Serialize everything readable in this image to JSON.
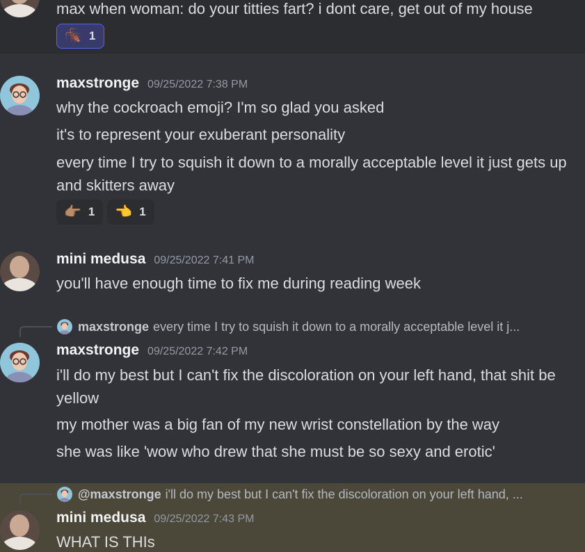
{
  "messages": [
    {
      "continued": true,
      "lines": [
        "max when woman: do your titties fart? i dont care, get out of my house"
      ],
      "reactions": [
        {
          "emoji": "🪳",
          "icon": "cockroach-icon",
          "count": "1",
          "active": true
        }
      ]
    },
    {
      "username": "maxstronge",
      "timestamp": "09/25/2022 7:38 PM",
      "lines": [
        "why the cockroach emoji? I'm so glad you asked",
        "it's to represent your exuberant personality",
        "every time I try to squish it down to a morally acceptable level it just gets up and skitters away"
      ],
      "reactions": [
        {
          "emoji": "👉🏽",
          "icon": "pointing-right-medium-skin-icon",
          "count": "1"
        },
        {
          "emoji": "👈",
          "icon": "pointing-left-icon",
          "count": "1"
        }
      ]
    },
    {
      "username": "mini medusa",
      "timestamp": "09/25/2022 7:41 PM",
      "lines": [
        "you'll have enough time to fix me during reading week"
      ]
    },
    {
      "reply": {
        "username": "maxstronge",
        "text": "every time I try to squish it down to a morally acceptable level it j..."
      },
      "username": "maxstronge",
      "timestamp": "09/25/2022 7:42 PM",
      "lines": [
        "i'll do my best but I can't fix the discoloration on your left hand, that shit be yellow",
        "my mother was a big fan of my new wrist constellation by the way",
        "she was like 'wow who drew that she must be so sexy and erotic'"
      ]
    },
    {
      "reply": {
        "username": "@maxstronge",
        "text": "i'll do my best but I can't fix the discoloration on your left hand, ..."
      },
      "username": "mini medusa",
      "timestamp": "09/25/2022 7:43 PM",
      "mentioned": true,
      "lines": [
        "WHAT IS THIs"
      ]
    }
  ],
  "colors": {
    "background": "#313338",
    "hover_background": "#2b2d31",
    "mention_highlight": "#4b4739",
    "username": "#f2f3f5",
    "timestamp": "#949ba4",
    "text": "#dbdee1",
    "active_reaction_border": "#5865f2"
  }
}
